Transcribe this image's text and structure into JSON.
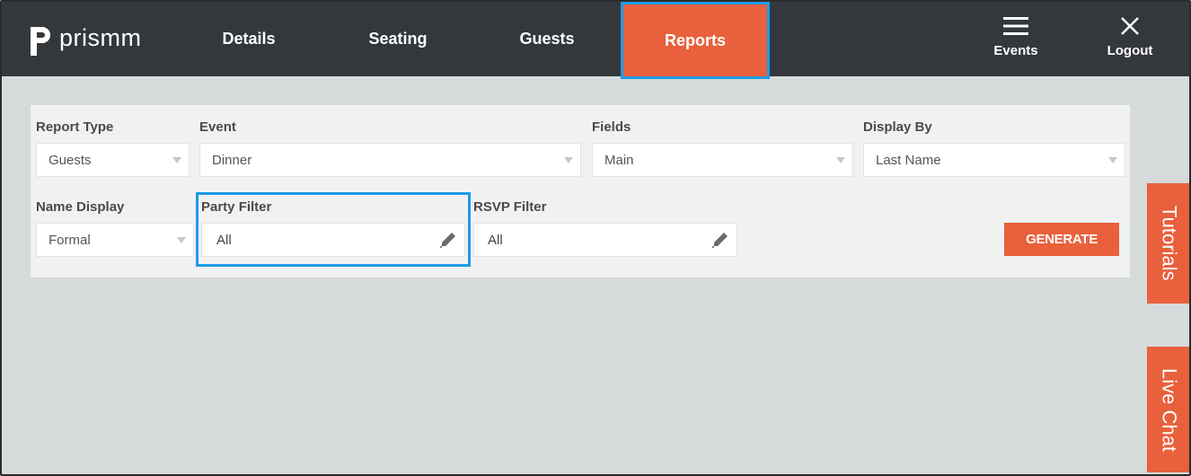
{
  "app": {
    "brand": "prismm"
  },
  "nav": {
    "tabs": [
      {
        "label": "Details"
      },
      {
        "label": "Seating"
      },
      {
        "label": "Guests"
      },
      {
        "label": "Reports"
      }
    ],
    "events_label": "Events",
    "logout_label": "Logout"
  },
  "filters": {
    "report_type": {
      "label": "Report Type",
      "value": "Guests"
    },
    "event": {
      "label": "Event",
      "value": "Dinner"
    },
    "fields": {
      "label": "Fields",
      "value": "Main"
    },
    "display_by": {
      "label": "Display By",
      "value": "Last Name"
    },
    "name_display": {
      "label": "Name Display",
      "value": "Formal"
    },
    "party_filter": {
      "label": "Party Filter",
      "value": "All"
    },
    "rsvp_filter": {
      "label": "RSVP Filter",
      "value": "All"
    },
    "generate_label": "GENERATE"
  },
  "side_tabs": {
    "tutorials": "Tutorials",
    "live_chat": "Live Chat"
  },
  "colors": {
    "accent": "#e8603c",
    "nav_bg": "#34383c",
    "highlight": "#1e9be8",
    "page_bg": "#d5dbdb"
  }
}
